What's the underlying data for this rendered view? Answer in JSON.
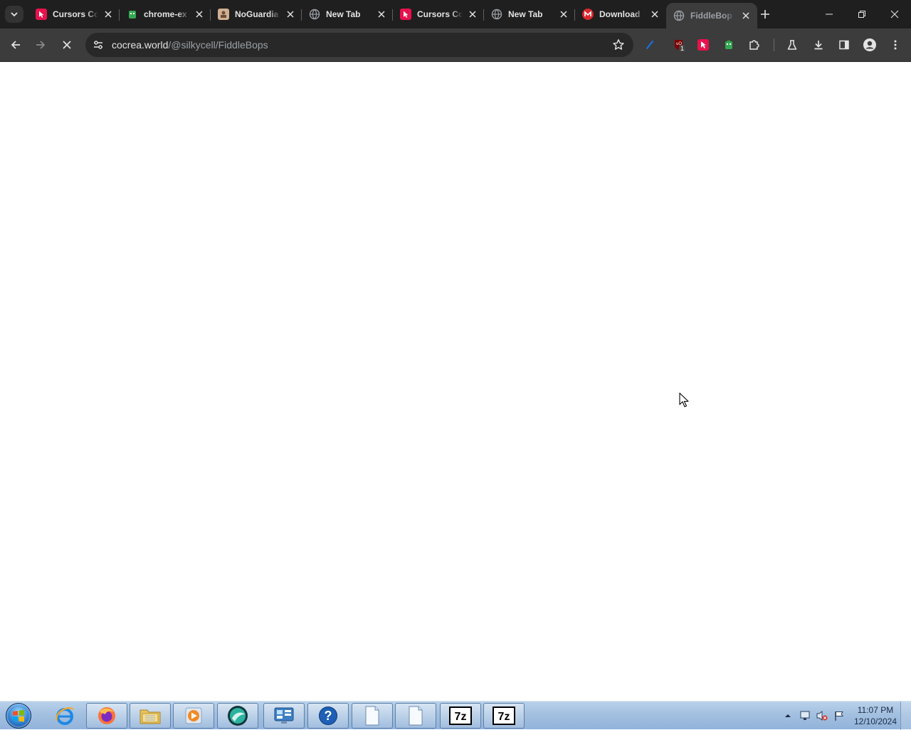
{
  "browser": {
    "tabs": [
      {
        "title": "Cursors Co",
        "favicon": "cursor-pink-icon",
        "favicon_color": "#e8114c",
        "active": false
      },
      {
        "title": "chrome-ex",
        "favicon": "green-bot-icon",
        "favicon_color": "#34a853",
        "active": false
      },
      {
        "title": "NoGuardia",
        "favicon": "photo-icon",
        "favicon_color": "#d0b090",
        "active": false
      },
      {
        "title": "New Tab",
        "favicon": "globe-icon",
        "favicon_color": "#9aa0a6",
        "active": false
      },
      {
        "title": "Cursors Co",
        "favicon": "cursor-pink-icon",
        "favicon_color": "#e8114c",
        "active": false
      },
      {
        "title": "New Tab",
        "favicon": "globe-icon",
        "favicon_color": "#9aa0a6",
        "active": false
      },
      {
        "title": "Download",
        "favicon": "mega-icon",
        "favicon_color": "#d9272e",
        "active": false
      },
      {
        "title": "FiddleBop",
        "favicon": "loading-icon",
        "favicon_color": "#9aa0a6",
        "active": true
      }
    ],
    "omnibox": {
      "domain": "cocrea.world",
      "path": "/@silkycell/FiddleBops"
    },
    "extensions": [
      {
        "name": "pen-extension-icon",
        "color": "#1a73e8"
      },
      {
        "name": "ublock-extension-icon",
        "color": "#800000",
        "badge": "1"
      },
      {
        "name": "cursor-extension-icon",
        "color": "#e8114c"
      },
      {
        "name": "green-bot-extension-icon",
        "color": "#34a853"
      }
    ]
  },
  "taskbar": {
    "clock_time": "11:07 PM",
    "clock_date": "12/10/2024"
  }
}
